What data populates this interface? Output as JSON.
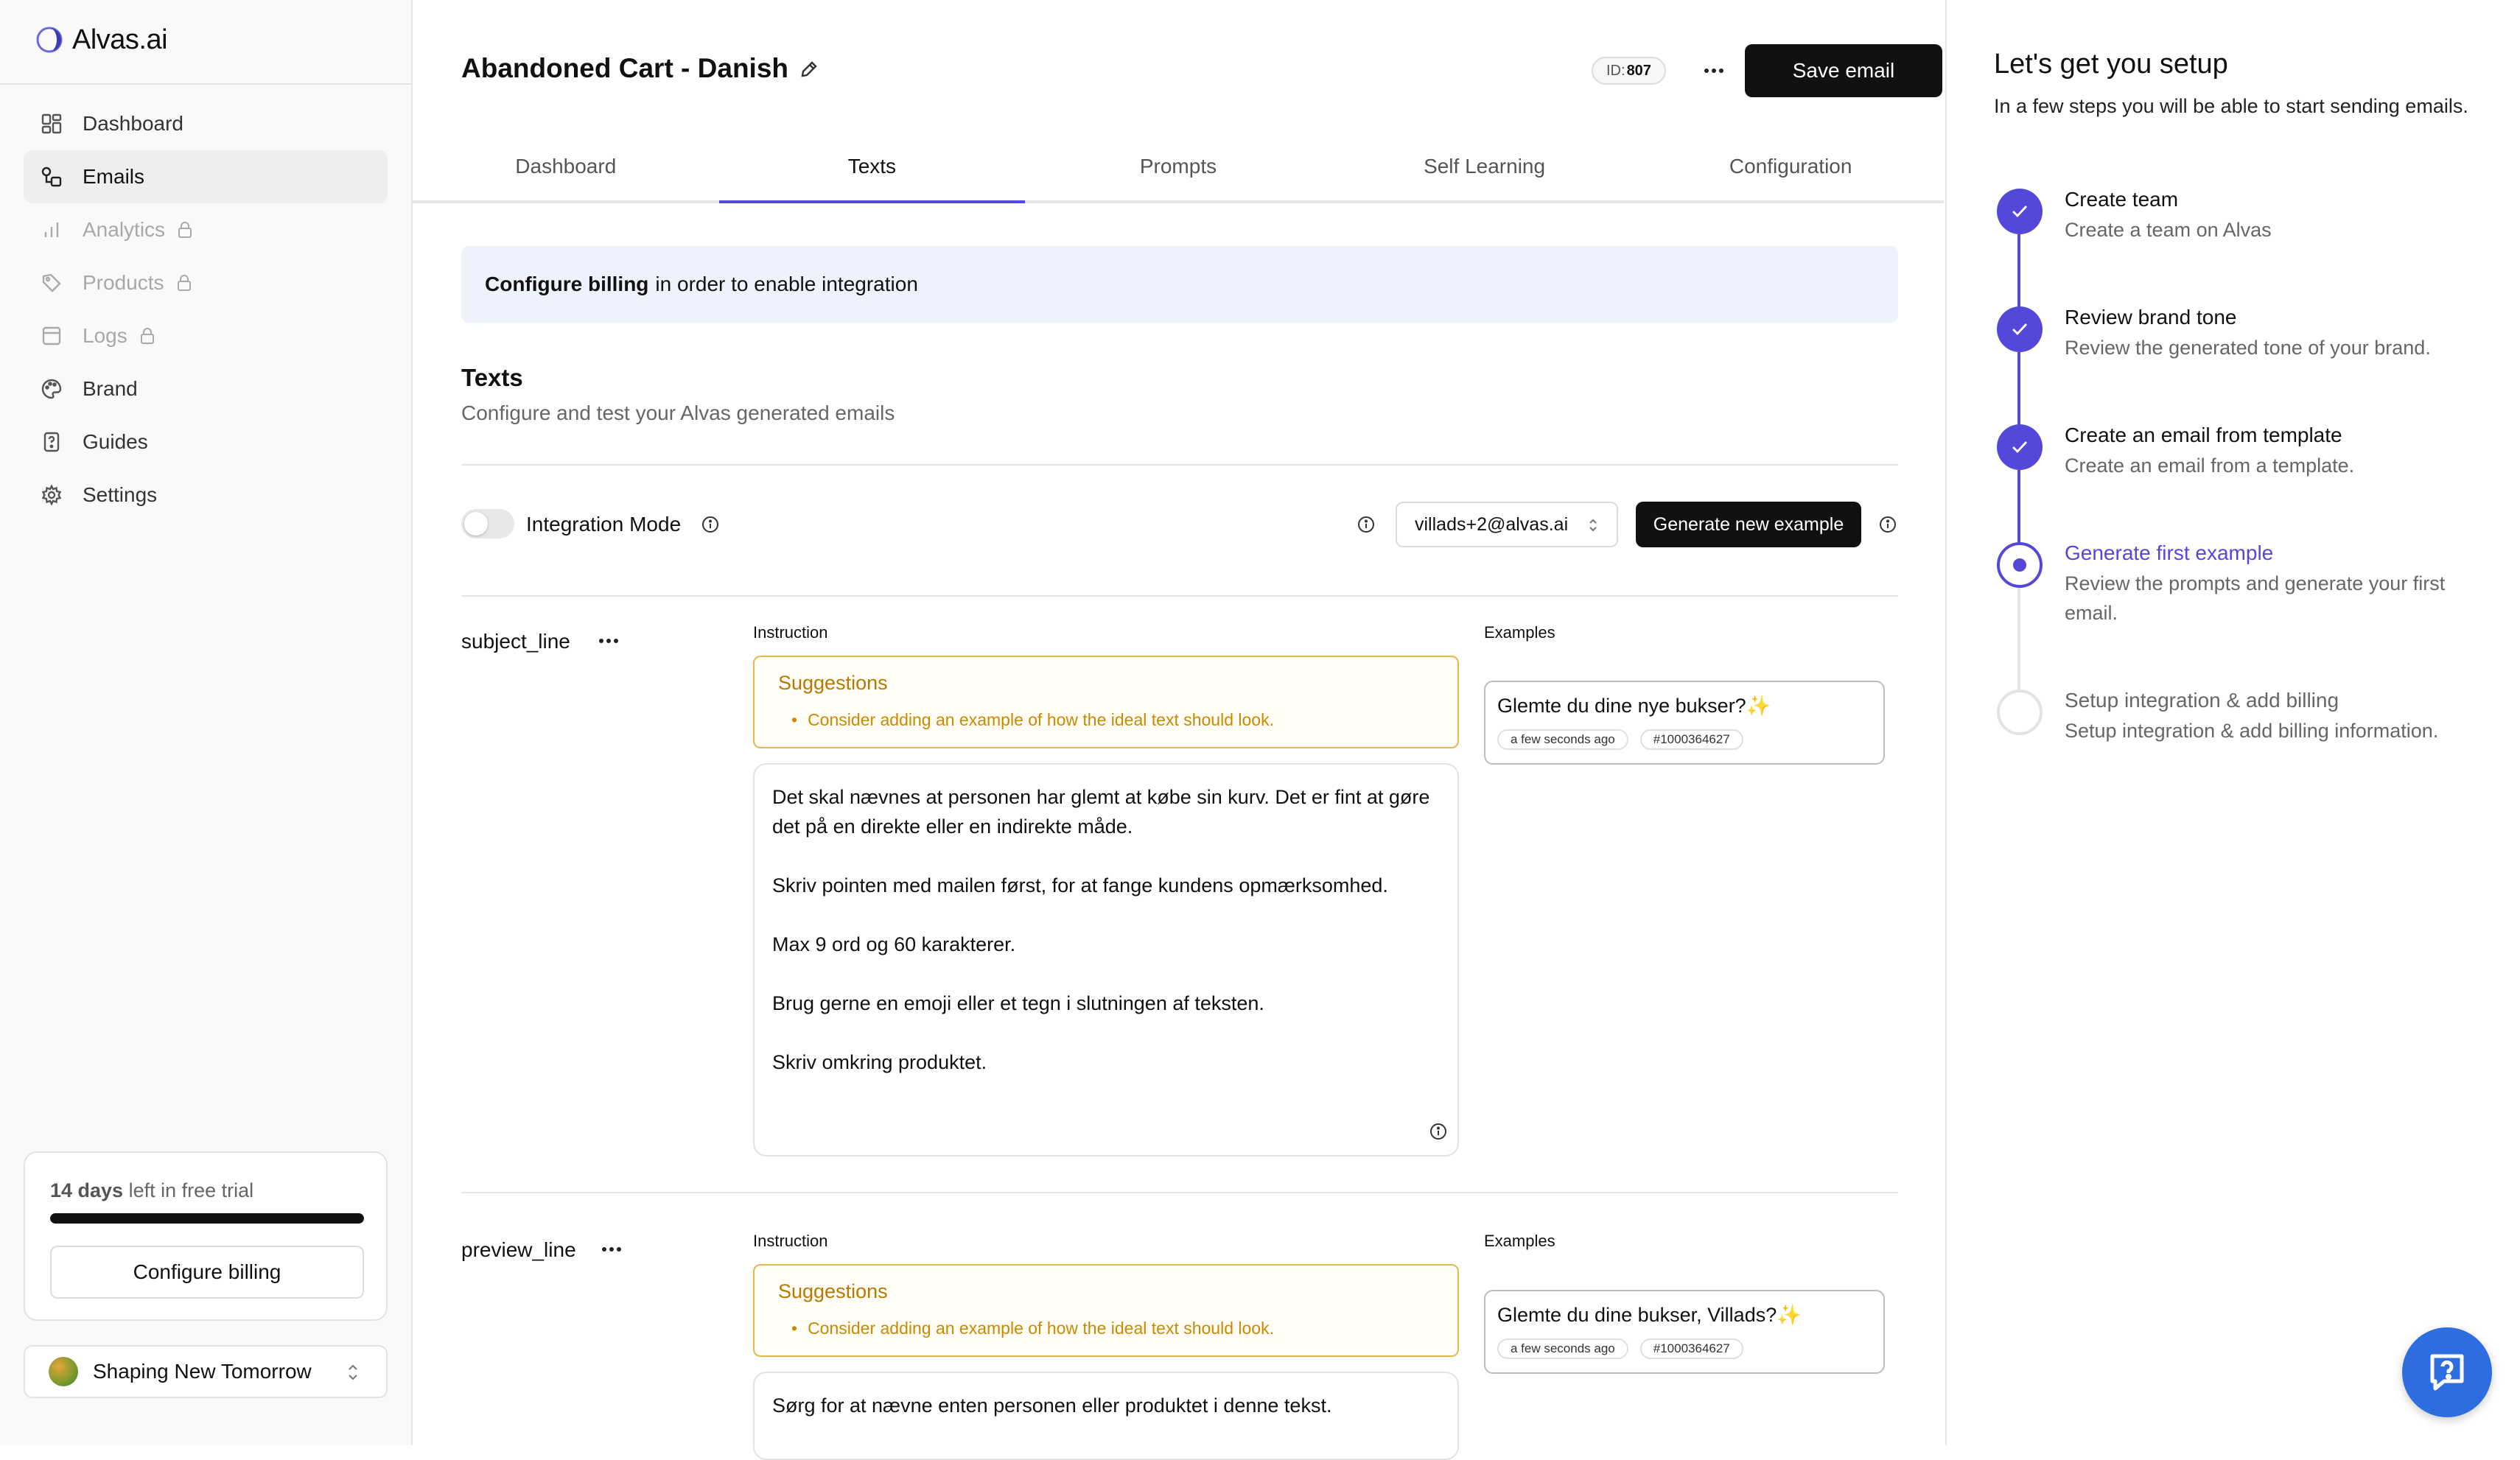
{
  "app": {
    "name": "Alvas.ai"
  },
  "sidebar": {
    "items": [
      {
        "label": "Dashboard",
        "icon": "dashboard-icon",
        "active": false,
        "locked": false
      },
      {
        "label": "Emails",
        "icon": "emails-icon",
        "active": true,
        "locked": false
      },
      {
        "label": "Analytics",
        "icon": "analytics-icon",
        "active": false,
        "locked": true
      },
      {
        "label": "Products",
        "icon": "products-icon",
        "active": false,
        "locked": true
      },
      {
        "label": "Logs",
        "icon": "logs-icon",
        "active": false,
        "locked": true
      },
      {
        "label": "Brand",
        "icon": "palette-icon",
        "active": false,
        "locked": false
      },
      {
        "label": "Guides",
        "icon": "guides-icon",
        "active": false,
        "locked": false
      },
      {
        "label": "Settings",
        "icon": "gear-icon",
        "active": false,
        "locked": false
      }
    ],
    "trial": {
      "days": "14 days",
      "suffix": "left in free trial",
      "progress": 1.0,
      "button": "Configure billing"
    },
    "team": {
      "name": "Shaping New Tomorrow"
    }
  },
  "header": {
    "title": "Abandoned Cart - Danish",
    "id_label": "ID:",
    "id_value": "807",
    "save_label": "Save email"
  },
  "tabs": [
    {
      "label": "Dashboard",
      "active": false
    },
    {
      "label": "Texts",
      "active": true
    },
    {
      "label": "Prompts",
      "active": false
    },
    {
      "label": "Self Learning",
      "active": false
    },
    {
      "label": "Configuration",
      "active": false
    }
  ],
  "notice": {
    "bold": "Configure billing",
    "rest": "in order to enable integration"
  },
  "section": {
    "title": "Texts",
    "subtitle": "Configure and test your Alvas generated emails"
  },
  "controls": {
    "integration_label": "Integration Mode",
    "integration_on": false,
    "email_value": "villads+2@alvas.ai",
    "generate_label": "Generate new example"
  },
  "fields": [
    {
      "name": "subject_line",
      "instruction_label": "Instruction",
      "examples_label": "Examples",
      "suggestions_title": "Suggestions",
      "suggestion": "Consider adding an example of how the ideal text should look.",
      "instruction_lines": [
        "Det skal nævnes at personen har glemt at købe sin kurv. Det er fint at gøre det på en direkte eller en indirekte måde.",
        "Skriv pointen med mailen først, for at fange kundens opmærksomhed.",
        "Max 9 ord og 60 karakterer.",
        "Brug gerne en emoji eller et tegn i slutningen af teksten.",
        "Skriv omkring produktet."
      ],
      "example": {
        "text": "Glemte du dine nye bukser?",
        "sparkle": "✨",
        "time": "a few seconds ago",
        "order": "#1000364627"
      }
    },
    {
      "name": "preview_line",
      "instruction_label": "Instruction",
      "examples_label": "Examples",
      "suggestions_title": "Suggestions",
      "suggestion": "Consider adding an example of how the ideal text should look.",
      "instruction_lines": [
        "Sørg for at nævne enten personen eller produktet i denne tekst."
      ],
      "example": {
        "text": "Glemte du dine bukser, Villads?",
        "sparkle": "✨",
        "time": "a few seconds ago",
        "order": "#1000364627"
      }
    }
  ],
  "setup": {
    "title": "Let's get you setup",
    "subtitle": "In a few steps you will be able to start sending emails.",
    "steps": [
      {
        "title": "Create team",
        "desc": "Create a team on Alvas",
        "status": "done"
      },
      {
        "title": "Review brand tone",
        "desc": "Review the generated tone of your brand.",
        "status": "done"
      },
      {
        "title": "Create an email from template",
        "desc": "Create an email from a template.",
        "status": "done"
      },
      {
        "title": "Generate first example",
        "desc": "Review the prompts and generate your first email.",
        "status": "current"
      },
      {
        "title": "Setup integration & add billing",
        "desc": "Setup integration & add billing information.",
        "status": "todo"
      }
    ]
  },
  "colors": {
    "accent": "#5448db",
    "suggest_border": "#e3b84e",
    "suggest_text": "#c98a00",
    "help": "#2d6de0"
  }
}
